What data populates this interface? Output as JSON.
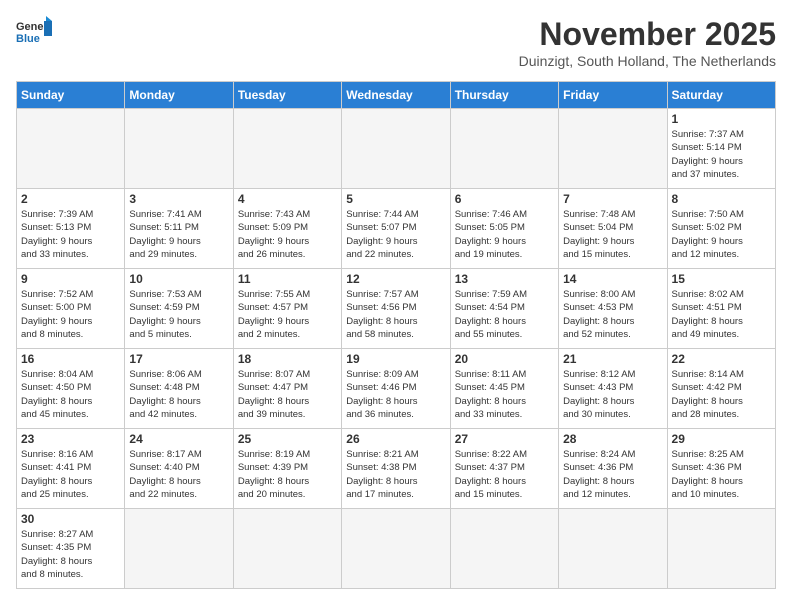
{
  "header": {
    "logo_general": "General",
    "logo_blue": "Blue",
    "month_title": "November 2025",
    "location": "Duinzigt, South Holland, The Netherlands"
  },
  "weekdays": [
    "Sunday",
    "Monday",
    "Tuesday",
    "Wednesday",
    "Thursday",
    "Friday",
    "Saturday"
  ],
  "weeks": [
    [
      {
        "day": "",
        "info": ""
      },
      {
        "day": "",
        "info": ""
      },
      {
        "day": "",
        "info": ""
      },
      {
        "day": "",
        "info": ""
      },
      {
        "day": "",
        "info": ""
      },
      {
        "day": "",
        "info": ""
      },
      {
        "day": "1",
        "info": "Sunrise: 7:37 AM\nSunset: 5:14 PM\nDaylight: 9 hours\nand 37 minutes."
      }
    ],
    [
      {
        "day": "2",
        "info": "Sunrise: 7:39 AM\nSunset: 5:13 PM\nDaylight: 9 hours\nand 33 minutes."
      },
      {
        "day": "3",
        "info": "Sunrise: 7:41 AM\nSunset: 5:11 PM\nDaylight: 9 hours\nand 29 minutes."
      },
      {
        "day": "4",
        "info": "Sunrise: 7:43 AM\nSunset: 5:09 PM\nDaylight: 9 hours\nand 26 minutes."
      },
      {
        "day": "5",
        "info": "Sunrise: 7:44 AM\nSunset: 5:07 PM\nDaylight: 9 hours\nand 22 minutes."
      },
      {
        "day": "6",
        "info": "Sunrise: 7:46 AM\nSunset: 5:05 PM\nDaylight: 9 hours\nand 19 minutes."
      },
      {
        "day": "7",
        "info": "Sunrise: 7:48 AM\nSunset: 5:04 PM\nDaylight: 9 hours\nand 15 minutes."
      },
      {
        "day": "8",
        "info": "Sunrise: 7:50 AM\nSunset: 5:02 PM\nDaylight: 9 hours\nand 12 minutes."
      }
    ],
    [
      {
        "day": "9",
        "info": "Sunrise: 7:52 AM\nSunset: 5:00 PM\nDaylight: 9 hours\nand 8 minutes."
      },
      {
        "day": "10",
        "info": "Sunrise: 7:53 AM\nSunset: 4:59 PM\nDaylight: 9 hours\nand 5 minutes."
      },
      {
        "day": "11",
        "info": "Sunrise: 7:55 AM\nSunset: 4:57 PM\nDaylight: 9 hours\nand 2 minutes."
      },
      {
        "day": "12",
        "info": "Sunrise: 7:57 AM\nSunset: 4:56 PM\nDaylight: 8 hours\nand 58 minutes."
      },
      {
        "day": "13",
        "info": "Sunrise: 7:59 AM\nSunset: 4:54 PM\nDaylight: 8 hours\nand 55 minutes."
      },
      {
        "day": "14",
        "info": "Sunrise: 8:00 AM\nSunset: 4:53 PM\nDaylight: 8 hours\nand 52 minutes."
      },
      {
        "day": "15",
        "info": "Sunrise: 8:02 AM\nSunset: 4:51 PM\nDaylight: 8 hours\nand 49 minutes."
      }
    ],
    [
      {
        "day": "16",
        "info": "Sunrise: 8:04 AM\nSunset: 4:50 PM\nDaylight: 8 hours\nand 45 minutes."
      },
      {
        "day": "17",
        "info": "Sunrise: 8:06 AM\nSunset: 4:48 PM\nDaylight: 8 hours\nand 42 minutes."
      },
      {
        "day": "18",
        "info": "Sunrise: 8:07 AM\nSunset: 4:47 PM\nDaylight: 8 hours\nand 39 minutes."
      },
      {
        "day": "19",
        "info": "Sunrise: 8:09 AM\nSunset: 4:46 PM\nDaylight: 8 hours\nand 36 minutes."
      },
      {
        "day": "20",
        "info": "Sunrise: 8:11 AM\nSunset: 4:45 PM\nDaylight: 8 hours\nand 33 minutes."
      },
      {
        "day": "21",
        "info": "Sunrise: 8:12 AM\nSunset: 4:43 PM\nDaylight: 8 hours\nand 30 minutes."
      },
      {
        "day": "22",
        "info": "Sunrise: 8:14 AM\nSunset: 4:42 PM\nDaylight: 8 hours\nand 28 minutes."
      }
    ],
    [
      {
        "day": "23",
        "info": "Sunrise: 8:16 AM\nSunset: 4:41 PM\nDaylight: 8 hours\nand 25 minutes."
      },
      {
        "day": "24",
        "info": "Sunrise: 8:17 AM\nSunset: 4:40 PM\nDaylight: 8 hours\nand 22 minutes."
      },
      {
        "day": "25",
        "info": "Sunrise: 8:19 AM\nSunset: 4:39 PM\nDaylight: 8 hours\nand 20 minutes."
      },
      {
        "day": "26",
        "info": "Sunrise: 8:21 AM\nSunset: 4:38 PM\nDaylight: 8 hours\nand 17 minutes."
      },
      {
        "day": "27",
        "info": "Sunrise: 8:22 AM\nSunset: 4:37 PM\nDaylight: 8 hours\nand 15 minutes."
      },
      {
        "day": "28",
        "info": "Sunrise: 8:24 AM\nSunset: 4:36 PM\nDaylight: 8 hours\nand 12 minutes."
      },
      {
        "day": "29",
        "info": "Sunrise: 8:25 AM\nSunset: 4:36 PM\nDaylight: 8 hours\nand 10 minutes."
      }
    ],
    [
      {
        "day": "30",
        "info": "Sunrise: 8:27 AM\nSunset: 4:35 PM\nDaylight: 8 hours\nand 8 minutes."
      },
      {
        "day": "",
        "info": ""
      },
      {
        "day": "",
        "info": ""
      },
      {
        "day": "",
        "info": ""
      },
      {
        "day": "",
        "info": ""
      },
      {
        "day": "",
        "info": ""
      },
      {
        "day": "",
        "info": ""
      }
    ]
  ]
}
